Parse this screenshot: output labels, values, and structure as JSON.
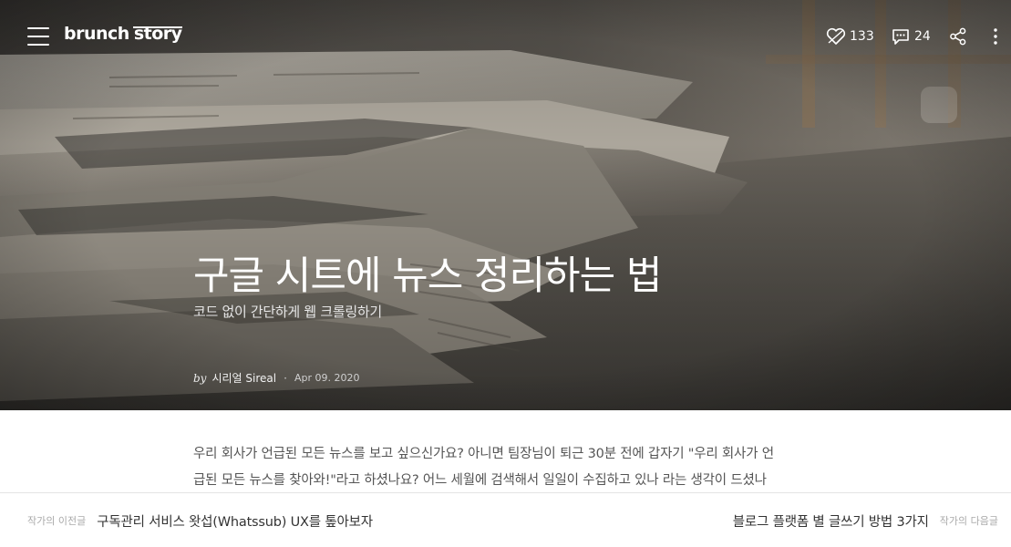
{
  "app": {
    "logo_part1": "brunch",
    "logo_part2": "story"
  },
  "header": {
    "like_count": "133",
    "comment_count": "24",
    "icons": [
      "menu-icon",
      "like-icon",
      "comment-icon",
      "share-icon",
      "more-icon"
    ]
  },
  "post": {
    "title": "구글 시트에 뉴스 정리하는 법",
    "subtitle": "코드 없이 간단하게 웹 크롤링하기",
    "by": "by",
    "author": "시리얼 Sireal",
    "date": "Apr 09. 2020",
    "body_lines": [
      "우리 회사가 언급된 모든 뉴스를 보고 싶으신가요? 아니면 팀장님이 퇴근 30분 전에 갑자기 \"우리 회사가 언",
      "급된 모든 뉴스를 찾아와!\"라고 하셨나요? 어느 세월에 검색해서 일일이 수집하고 있나 라는 생각이 드셨나"
    ]
  },
  "bottom_nav": {
    "prev_kicker": "작가의 이전글",
    "prev_title": "구독관리 서비스 왓섭(Whatssub) UX를 톺아보자",
    "next_title": "블로그 플랫폼 별 글쓰기 방법 3가지",
    "next_kicker": "작가의 다음글"
  },
  "colors": {
    "hero_dark": "#2b2a28",
    "hero_mid": "#6e6a63",
    "paper_light": "#b9b4aa",
    "text_white": "#ffffff",
    "divider": "#e4e4e4"
  }
}
